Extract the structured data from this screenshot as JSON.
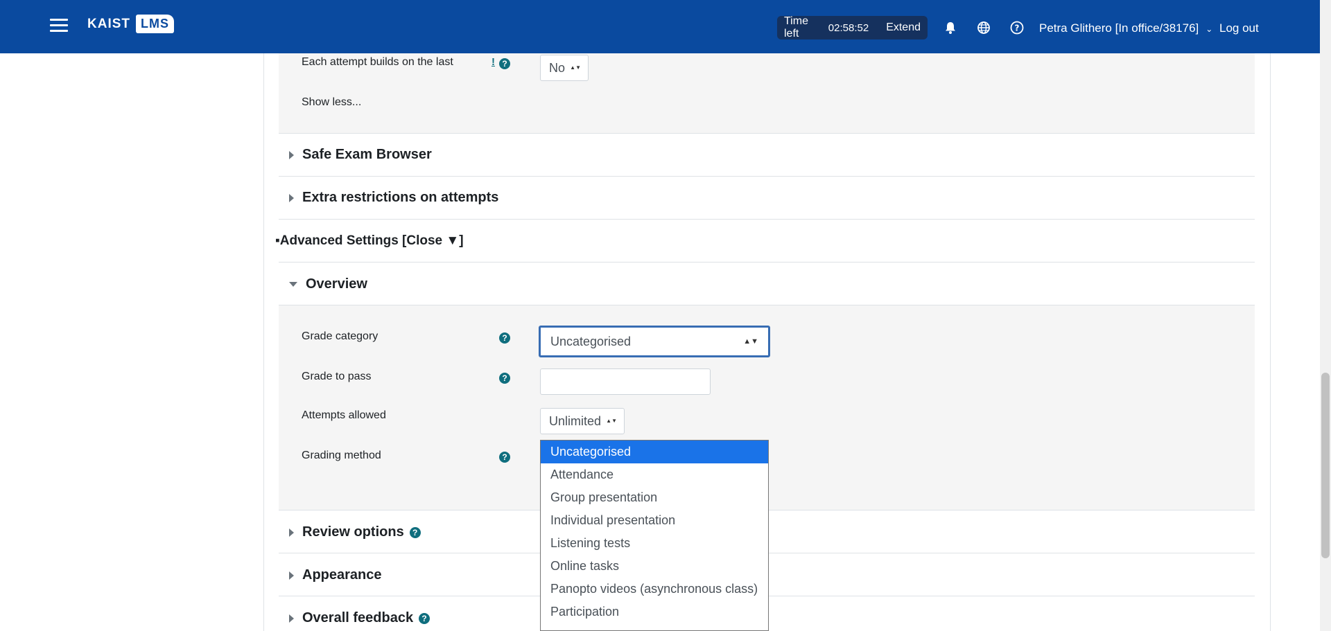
{
  "navbar": {
    "logo_kaist": "KAIST",
    "logo_lms": "LMS",
    "timer_label": "Time left",
    "timer_value": "02:58:52",
    "extend_label": "Extend",
    "user": "Petra Glithero [In office/38176]",
    "logout_label": "Log out"
  },
  "top_panel": {
    "attempt_builds_label": "Each attempt builds on the last",
    "attempt_builds_warning": "!",
    "attempt_builds_value": "No",
    "show_less": "Show less..."
  },
  "sections": {
    "safe_exam_browser": "Safe Exam Browser",
    "extra_restrictions": "Extra restrictions on attempts",
    "advanced_settings": "▪Advanced Settings [Close ▼]",
    "overview": "Overview",
    "review_options": "Review options",
    "appearance": "Appearance",
    "overall_feedback": "Overall feedback"
  },
  "overview": {
    "grade_category_label": "Grade category",
    "grade_category_value": "Uncategorised",
    "grade_to_pass_label": "Grade to pass",
    "grade_to_pass_value": "",
    "attempts_allowed_label": "Attempts allowed",
    "attempts_allowed_value": "Unlimited",
    "grading_method_label": "Grading method"
  },
  "grade_category_options": [
    "Uncategorised",
    "Attendance",
    "Group presentation",
    "Individual presentation",
    "Listening tests",
    "Online tasks",
    "Panopto videos (asynchronous class)",
    "Participation"
  ],
  "help_glyph": "?",
  "colors": {
    "navbar": "#0a4a9f",
    "timer_bg": "#15315e",
    "help_icon": "#0f6e7e",
    "focus_border": "#386db3",
    "dropdown_selected": "#1a73e8"
  }
}
